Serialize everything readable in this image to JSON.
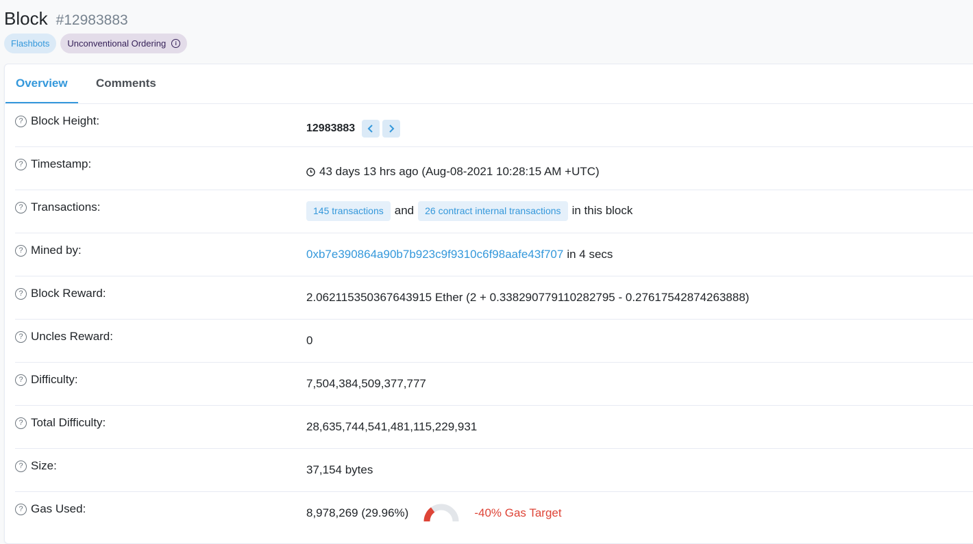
{
  "header": {
    "title": "Block",
    "subtitle": "#12983883",
    "badges": {
      "flashbots": "Flashbots",
      "ordering": "Unconventional Ordering"
    }
  },
  "tabs": {
    "overview": "Overview",
    "comments": "Comments"
  },
  "rows": {
    "block_height": {
      "label": "Block Height:",
      "value": "12983883"
    },
    "timestamp": {
      "label": "Timestamp:",
      "value": "43 days 13 hrs ago (Aug-08-2021 10:28:15 AM +UTC)"
    },
    "transactions": {
      "label": "Transactions:",
      "txs": "145 transactions",
      "and": "and",
      "internal": "26 contract internal transactions",
      "suffix": "in this block"
    },
    "mined_by": {
      "label": "Mined by:",
      "address": "0xb7e390864a90b7b923c9f9310c6f98aafe43f707",
      "suffix": "in 4 secs"
    },
    "block_reward": {
      "label": "Block Reward:",
      "value": "2.062115350367643915 Ether (2 + 0.338290779110282795 - 0.27617542874263888)"
    },
    "uncles_reward": {
      "label": "Uncles Reward:",
      "value": "0"
    },
    "difficulty": {
      "label": "Difficulty:",
      "value": "7,504,384,509,377,777"
    },
    "total_difficulty": {
      "label": "Total Difficulty:",
      "value": "28,635,744,541,481,115,229,931"
    },
    "size": {
      "label": "Size:",
      "value": "37,154 bytes"
    },
    "gas_used": {
      "label": "Gas Used:",
      "value": "8,978,269 (29.96%)",
      "gauge_fraction": 0.2996,
      "target": "-40% Gas Target"
    }
  },
  "colors": {
    "accent": "#3498db",
    "badge_purple_text": "#341f57",
    "danger": "#de4437"
  },
  "icons": {
    "help": "question-circle-icon",
    "clock": "clock-icon",
    "prev": "chevron-left-icon",
    "next": "chevron-right-icon",
    "info": "info-circle-icon"
  }
}
